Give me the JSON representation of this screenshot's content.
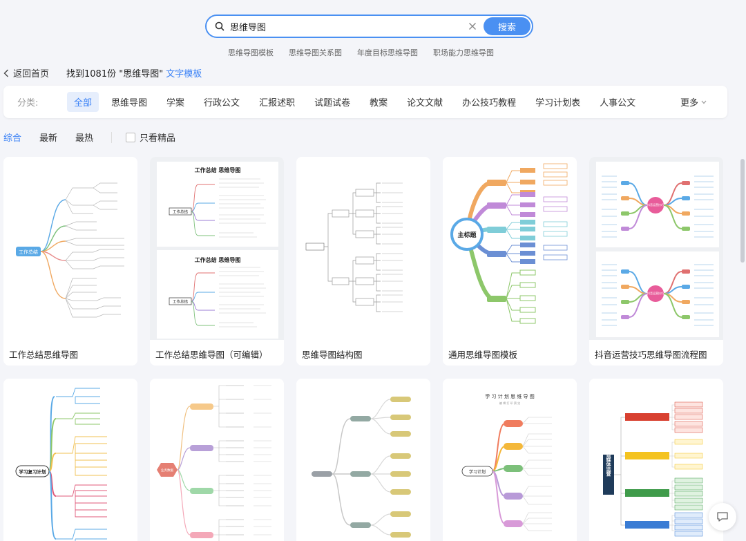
{
  "search": {
    "value": "思维导图",
    "button": "搜索"
  },
  "hot_tags": [
    "思维导图模板",
    "思维导图关系图",
    "年度目标思维导图",
    "职场能力思维导图"
  ],
  "back_label": "返回首页",
  "result": {
    "prefix": "找到1081份 \"思维导图\"",
    "link": "文字模板"
  },
  "categories": {
    "label": "分类:",
    "items": [
      "全部",
      "思维导图",
      "学案",
      "行政公文",
      "汇报述职",
      "试题试卷",
      "教案",
      "论文文献",
      "办公技巧教程",
      "学习计划表",
      "人事公文"
    ],
    "more": "更多"
  },
  "sort": {
    "items": [
      "综合",
      "最新",
      "最热"
    ],
    "featured": "只看精品"
  },
  "cards": [
    {
      "title": "工作总结思维导图",
      "center": "工作总结"
    },
    {
      "title": "工作总结思维导图（可编辑）",
      "heading": "工作总结 思维导图",
      "center": "工作总结"
    },
    {
      "title": "思维导图结构图"
    },
    {
      "title": "通用思维导图模板",
      "center": "主标题"
    },
    {
      "title": "抖音运营技巧思维导图流程图",
      "center": "抖音运营技巧"
    },
    {
      "title": "学习复习计划",
      "center": "学习复习计划"
    },
    {
      "title": "",
      "center": "业务数据"
    },
    {
      "title": ""
    },
    {
      "heading": "学 习 计 划 思 维 导 图",
      "subheading": "编 辑 打 印 预 览",
      "center": "学习计划"
    },
    {
      "center": "自媒体运营"
    }
  ],
  "colors": {
    "accent": "#3b82f6",
    "search_border": "#4a90f2"
  }
}
